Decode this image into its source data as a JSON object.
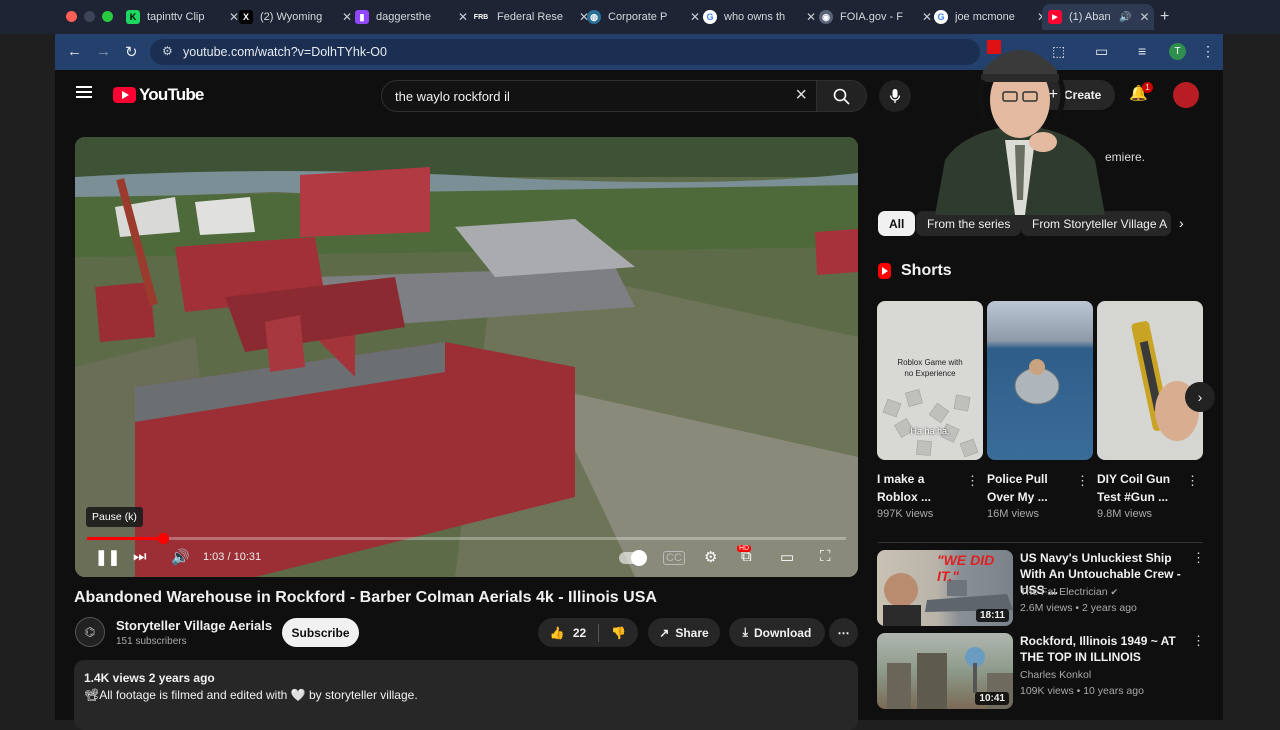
{
  "browser": {
    "tabs": [
      {
        "title": "tapinttv Clip",
        "favicon": "kick-icon",
        "fav_color": "#1ed760",
        "fav_text": "K"
      },
      {
        "title": "(2) Wyoming",
        "favicon": "x-icon",
        "fav_color": "#000000",
        "fav_text": "X"
      },
      {
        "title": "daggersthe",
        "favicon": "twitch-icon",
        "fav_color": "#9146ff",
        "fav_text": "▮"
      },
      {
        "title": "Federal Rese",
        "favicon": "frb-icon",
        "fav_color": "#1e2433",
        "fav_text": "FRB"
      },
      {
        "title": "Corporate P",
        "favicon": "globe-icon",
        "fav_color": "#2a6f97",
        "fav_text": "◍"
      },
      {
        "title": "who owns th",
        "favicon": "google-icon",
        "fav_color": "#ffffff",
        "fav_text": "G"
      },
      {
        "title": "FOIA.gov - F",
        "favicon": "seal-icon",
        "fav_color": "#5a6478",
        "fav_text": "◉"
      },
      {
        "title": "joe mcmone",
        "favicon": "google-icon",
        "fav_color": "#ffffff",
        "fav_text": "G"
      },
      {
        "title": "(1) Aban",
        "favicon": "youtube-icon",
        "fav_color": "#ff0033",
        "fav_text": "▶"
      }
    ],
    "url": "youtube.com/watch?v=DolhTYhk-O0",
    "profile_initial": "T"
  },
  "youtube": {
    "logo_text": "YouTube",
    "search_value": "the waylo rockford il",
    "create_label": "Create",
    "notification_count": "1"
  },
  "player": {
    "tooltip": "Pause (k)",
    "time": "1:03 / 10:31",
    "progress": 0.1,
    "hd_badge": "HD"
  },
  "video": {
    "title": "Abandoned Warehouse in Rockford - Barber Colman Aerials 4k - Illinois USA",
    "channel": "Storyteller Village Aerials",
    "subscribers": "151 subscribers",
    "subscribe_label": "Subscribe",
    "likes": "22",
    "share_label": "Share",
    "download_label": "Download",
    "views_date": "1.4K views  2 years ago",
    "description": "📽All footage is filmed and edited with 🤍 by storyteller village."
  },
  "sidebar": {
    "premiere_fragment": "emiere.",
    "chips": [
      "All",
      "From the series",
      "From Storyteller Village A"
    ],
    "shorts_title": "Shorts",
    "shorts": [
      {
        "title": "I make a Roblox ...",
        "views": "997K views",
        "thumb_text_1": "Roblox Game with no Experience",
        "thumb_text_2": "Ha ha ha."
      },
      {
        "title": "Police Pull Over My ...",
        "views": "16M views"
      },
      {
        "title": "DIY Coil Gun Test #Gun ...",
        "views": "9.8M views"
      }
    ],
    "recommended": [
      {
        "title": "US Navy's Unluckiest Ship With An Untouchable Crew - USS ...",
        "channel": "The Fat Electrician",
        "meta": "2.6M views • 2 years ago",
        "duration": "18:11",
        "thumb_text": "\"WE DID IT.\""
      },
      {
        "title": "Rockford, Illinois 1949 ~ AT THE TOP IN ILLINOIS",
        "channel": "Charles Konkol",
        "meta": "109K views • 10 years ago",
        "duration": "10:41"
      }
    ]
  }
}
